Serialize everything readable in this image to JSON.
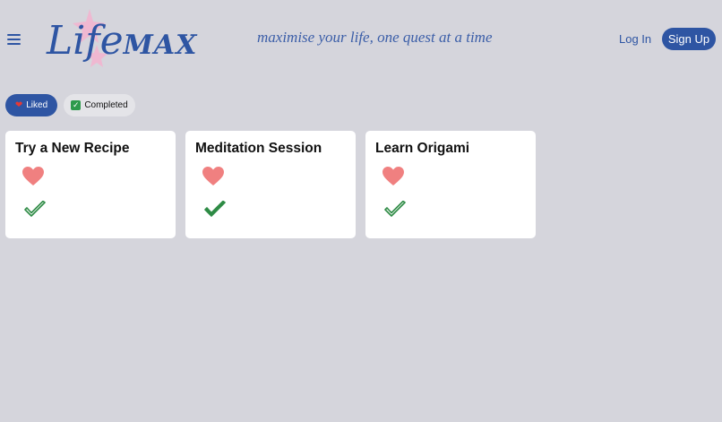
{
  "header": {
    "logo": {
      "part_a": "Life",
      "part_b": "MAX"
    },
    "tagline": "maximise your life, one quest at a time",
    "login_label": "Log In",
    "signup_label": "Sign Up"
  },
  "filters": [
    {
      "label": "Liked",
      "icon": "heart-icon",
      "active": true
    },
    {
      "label": "Completed",
      "icon": "check-box-icon",
      "active": false
    }
  ],
  "cards": [
    {
      "title": "Try a New Recipe",
      "liked": true,
      "completed": false
    },
    {
      "title": "Meditation Session",
      "liked": true,
      "completed": true
    },
    {
      "title": "Learn Origami",
      "liked": true,
      "completed": false
    }
  ],
  "colors": {
    "background": "#d5d5dc",
    "brand": "#2e55a3",
    "heart": "#f08080",
    "check": "#2e8b45",
    "star": "#f3b3cf"
  }
}
